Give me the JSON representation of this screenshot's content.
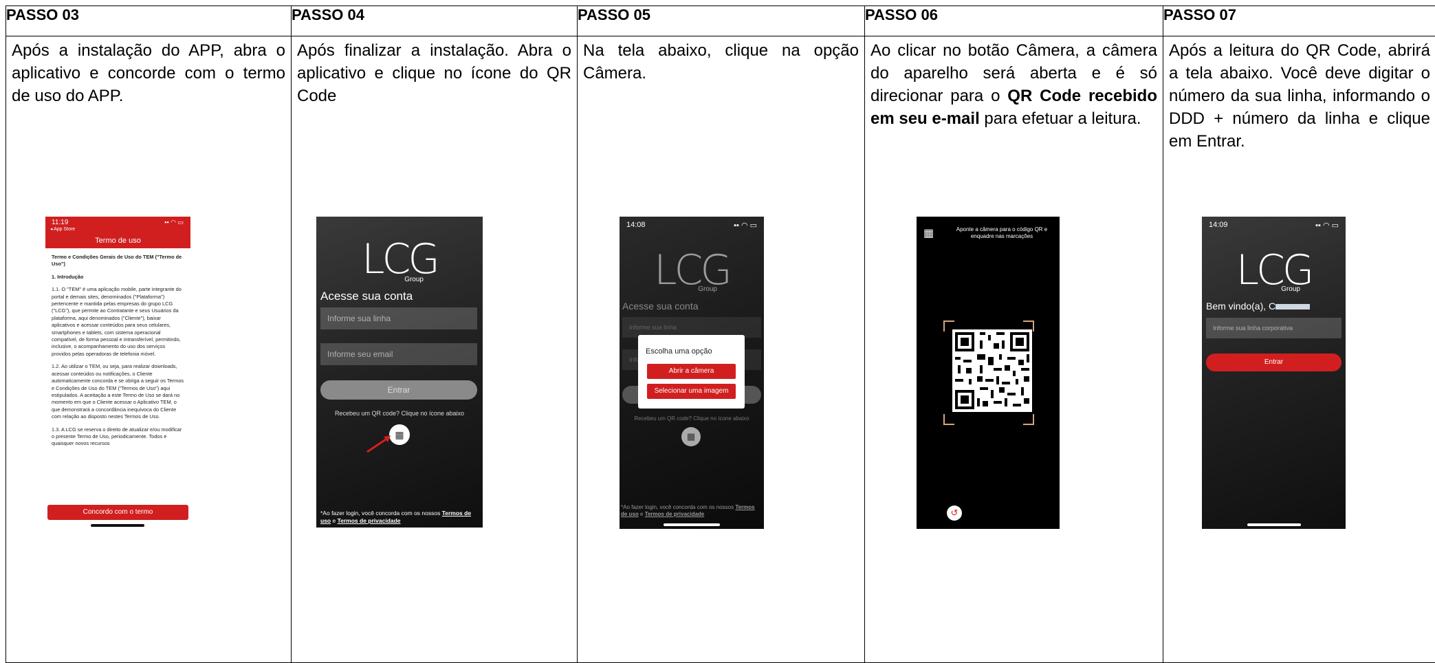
{
  "steps": [
    {
      "header": "PASSO 03",
      "text": "Após a instalação do APP, abra o aplicativo e concorde com o termo de uso do APP."
    },
    {
      "header": "PASSO 04",
      "text": "Após finalizar a instalação. Abra o aplicativo e clique no ícone do QR Code"
    },
    {
      "header": "PASSO 05",
      "text": "Na tela abaixo, clique na opção Câmera."
    },
    {
      "header": "PASSO 06",
      "text_a": "Ao clicar no botão Câmera, a câmera do aparelho será aberta e é só direcionar para o ",
      "text_b": "QR Code recebido em seu e-mail",
      "text_c": " para efetuar a leitura."
    },
    {
      "header": "PASSO 07",
      "text": "Após a leitura do QR Code, abrirá a tela abaixo. Você deve digitar o número da sua linha, informando o DDD + número da linha e clique em Entrar."
    }
  ],
  "phone1": {
    "time": "11:19",
    "back": "◂ App Store",
    "title": "Termo de uso",
    "doc_title": "Termo e Condições Gerais de Uso do TEM (\"Termo de Uso\")",
    "section": "1. Introdução",
    "p1": "1.1. O \"TEM\" é uma aplicação mobile, parte integrante do portal e demais sites, denominados (\"Plataforma\") pertencente e mantida pelas empresas do grupo LCG (\"LCG\"), que permite ao Contratante e seus Usuários da plataforma, aqui denominados (\"Cliente\"), baixar aplicativos e acessar conteúdos para seus celulares, smartphones e tablets, com sistema operacional compatível, de forma pessoal e intransferível, permitindo, inclusive, o acompanhamento do uso dos serviços providos pelas operadoras de telefonia móvel.",
    "p2": "1.2. Ao utilizar o TEM, ou seja, para realizar downloads, acessar conteúdos ou notificações, o Cliente automaticamente concorda e se obriga a seguir os Termos e Condições de Uso do TEM (\"Termos de Uso\") aqui estipulados. A aceitação a este Termo de Uso se dará no momento em que o Cliente acessar o Aplicativo TEM, o que demonstrará a concordância inequívoca do Cliente com relação ao disposto nestes Termos de Uso.",
    "p3": "1.3. A LCG se reserva o direito de atualizar e/ou modificar o presente Termo de Uso, periodicamente. Todos e quaisquer novos recursos",
    "agree": "Concordo com o termo"
  },
  "phone2": {
    "logo": "LCG",
    "group": "Group",
    "heading": "Acesse sua conta",
    "line_ph": "Informe sua linha",
    "email_ph": "Informe seu email",
    "enter": "Entrar",
    "qr_hint": "Recebeu um QR code? Clique no ícone abaixo",
    "footer_a": "*Ao fazer login, você concorda com os nossos ",
    "terms": "Termos de uso",
    "footer_b": " e ",
    "privacy": "Termos de privacidade"
  },
  "phone3": {
    "time": "14:08",
    "logo": "LCG",
    "group": "Group",
    "heading": "Acesse sua conta",
    "line_ph": "Informe sua linha",
    "email_ph": "Infor",
    "dialog_title": "Escolha uma opção",
    "open_camera": "Abrir a câmera",
    "choose_image": "Selecionar uma imagem",
    "qr_hint": "Recebeu um QR code? Clique no ícone abaixo",
    "footer_a": "*Ao fazer login, você concorda com os nossos ",
    "terms": "Termos de uso",
    "footer_b": " e ",
    "privacy": "Termos de privacidade"
  },
  "phone4": {
    "instruction": "Aponte a câmera para o código QR e enquadre nas marcações"
  },
  "phone5": {
    "time": "14:09",
    "logo": "LCG",
    "group": "Group",
    "welcome": "Bem vindo(a), C",
    "line_ph": "Informe sua linha corporativa",
    "enter": "Entrar"
  },
  "colors": {
    "brand_red": "#d11f1f",
    "corner_orange": "#d8a57a"
  }
}
